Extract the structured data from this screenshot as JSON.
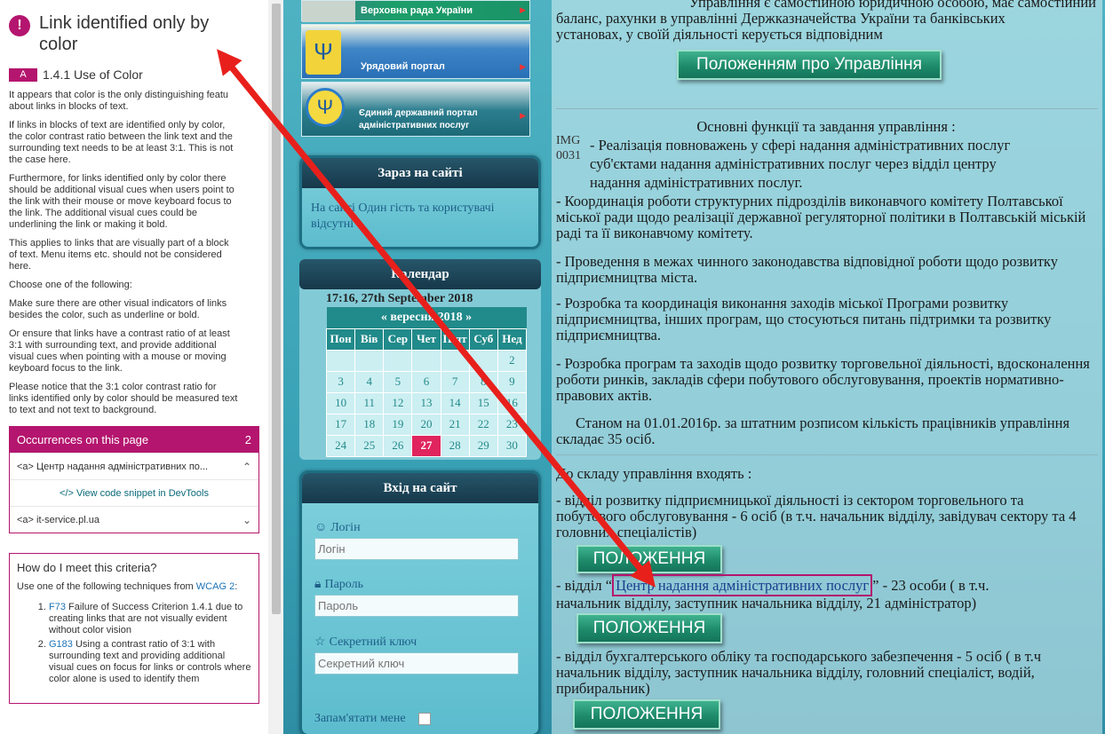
{
  "panel": {
    "title": "Link identified only by color",
    "level": "A",
    "criterion": "1.4.1 Use of Color",
    "paragraphs": [
      "It appears that color is the only distinguishing featu",
      "about links in blocks of text.",
      "If links in blocks of text are identified only by color,",
      "the color contrast ratio between the link text and the",
      "surrounding text needs to be at least 3:1. This is not",
      "the case here.",
      "Furthermore, for links identified only by color there",
      "should be additional visual cues when users point to",
      "the link with their mouse or move keyboard focus to",
      "the link. The additional visual cues could be",
      "underlining the link or making it bold.",
      "This applies to links that are visually part of a block",
      "of text. Menu items etc. should not be considered",
      "here.",
      "Choose one of the following:",
      "Make sure there are other visual indicators of links",
      "besides the color, such as underline or bold.",
      "Or ensure that links have a contrast ratio of at least",
      "3:1 with surrounding text, and provide additional",
      "visual cues when pointing with a mouse or moving",
      "keyboard focus to the link.",
      "Please notice that the 3:1 color contrast ratio for",
      "links identified only by color should be measured text",
      "to text and not text to background."
    ],
    "occurrences": {
      "label": "Occurrences on this page",
      "count": "2",
      "items": [
        {
          "text": "<a>  Центр надання адміністративних по...",
          "chevron": "⌃"
        },
        {
          "text": "<a>  it-service.pl.ua",
          "chevron": "⌄"
        }
      ],
      "snippet": "</> View code snippet in DevTools"
    },
    "how": {
      "title": "How do I meet this criteria?",
      "intro": "Use one of the following techniques from",
      "intro_link": "WCAG 2",
      "intro_tail": ":",
      "items": [
        {
          "code": "F73",
          "text": " Failure of Success Criterion 1.4.1 due to creating links that are not visually evident without color vision"
        },
        {
          "code": "G183",
          "text": " Using a contrast ratio of 3:1 with surrounding text and providing additional visual cues on focus for links or controls where color alone is used to identify them"
        }
      ]
    }
  },
  "site": {
    "banners": [
      "Верховна рада України",
      "Урядовий портал",
      "Єдиний державний портал адміністративних послуг"
    ],
    "now": {
      "title": "Зараз на сайті",
      "text": "На сайті Один гість та користувачі відсутні"
    },
    "calendar": {
      "title": "Календар",
      "datetime": "17:16, 27th September 2018",
      "month": "«  вересня 2018  »",
      "dows": [
        "Пон",
        "Вів",
        "Сер",
        "Чет",
        "П'ят",
        "Суб",
        "Нед"
      ],
      "weeks": [
        [
          "",
          "",
          "",
          "",
          "",
          "",
          "2"
        ],
        [
          "3",
          "4",
          "5",
          "6",
          "7",
          "8",
          "9"
        ],
        [
          "10",
          "11",
          "12",
          "13",
          "14",
          "15",
          "16"
        ],
        [
          "17",
          "18",
          "19",
          "20",
          "21",
          "22",
          "23"
        ],
        [
          "24",
          "25",
          "26",
          "27",
          "28",
          "29",
          "30"
        ]
      ],
      "today": "27"
    },
    "login": {
      "title": "Вхід на сайт",
      "login_label": "Логін",
      "login_placeholder": "Логін",
      "password_label": "Пароль",
      "password_placeholder": "Пароль",
      "secret_label": "Секретний ключ",
      "secret_placeholder": "Секретний ключ",
      "remember": "Запам'ятати мене"
    },
    "main": {
      "top1": "Управління є самостійною юридичною особою, має самостійний",
      "top2": "баланс, рахунки в управлінні Держказначейства України та банківських",
      "top3": "установах, у своїй діяльності керується відповідним",
      "btn_reg": "Положенням про Управління",
      "functions_title": "Основні  функції та завдання управління :",
      "img_alt": "IMG 0031",
      "f1a": "-  Реалізація повноважень у сфері надання адміністративних послуг",
      "f1b": "суб'єктами надання адміністративних послуг через відділ центру",
      "f1c": "надання адміністративних послуг.",
      "f2": "-  Координація роботи структурних підрозділів виконавчого комітету Полтавської міської ради щодо реалізації державної регуляторної політики в Полтавській міській раді та її виконавчому комітету.",
      "f3": "-  Проведення в межах чинного законодавства відповідної роботи щодо розвитку підприємництва міста.",
      "f4": "-  Розробка та координація виконання заходів міської Програми розвитку підприємництва, інших програм, що стосуються питань підтримки та розвитку підприємництва.",
      "f5": "-  Розробка програм та заходів щодо розвитку торговельної діяльності, вдосконалення роботи ринків, закладів сфери побутового обслуговування, проектів нормативно-правових актів.",
      "staff": "Станом на 01.01.2016р. за штатним розписом кількість працівників управління  складає 35  осіб.",
      "struct_title": "До складу управління входять :",
      "d1": "- відділ розвитку підприємницької діяльності із сектором торговельного та побутового обслуговування - 6 осіб  (в т.ч. начальник відділу, завідувач сектору та 4 головних спеціалістів)",
      "btn_pol": "ПОЛОЖЕННЯ",
      "d2_pre": "-    відділ “",
      "d2_link": "Центр надання адміністративних послуг",
      "d2_post": "” - 23 особи ( в т.ч.",
      "d2_b": "начальник відділу, заступник начальника відділу, 21 адміністратор)",
      "d3": "-     відділ бухгалтерського обліку та господарського забезпечення  - 5 осіб ( в т.ч начальник відділу, заступник начальника відділу, головний спеціаліст, водій, прибиральник)"
    }
  },
  "colors": {
    "accent": "#b4156e",
    "arrow": "#e8201c",
    "teal": "#218a8a"
  }
}
